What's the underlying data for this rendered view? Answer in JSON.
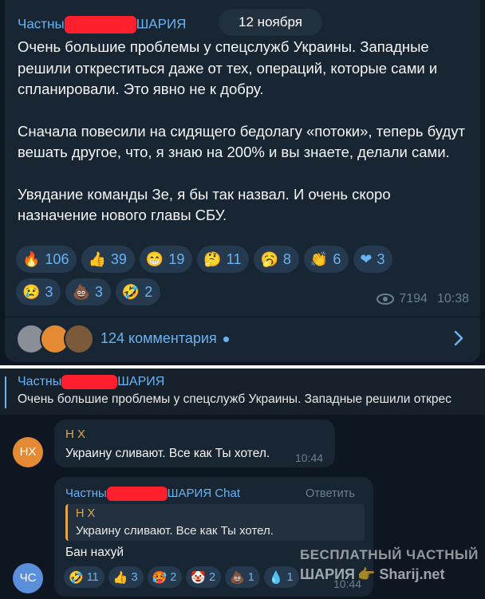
{
  "post": {
    "author_prefix": "Частны",
    "author_suffix": "ШАРИЯ",
    "date": "12 ноября",
    "paragraphs": [
      "Очень большие проблемы у спецслужб Украины. Западные решили откреститься даже от тех, операций, которые сами и спланировали. Это явно не к добру.",
      "Сначала повесили на сидящего бедолагу «потоки», теперь будут вешать другое, что, я знаю на 200% и вы знаете, делали сами.",
      "Увядание команды Зе, я бы так назвал. И очень скоро назначение нового главы СБУ."
    ],
    "reactions_row1": [
      {
        "icon": "fire-emoji",
        "emoji": "🔥",
        "count": "106"
      },
      {
        "icon": "thumbs-up-emoji",
        "emoji": "👍",
        "count": "39"
      },
      {
        "icon": "grin-emoji",
        "emoji": "😁",
        "count": "19"
      },
      {
        "icon": "thinking-emoji",
        "emoji": "🤔",
        "count": "11"
      },
      {
        "icon": "yawn-emoji",
        "emoji": "🥱",
        "count": "8"
      },
      {
        "icon": "clap-emoji",
        "emoji": "👏",
        "count": "6"
      },
      {
        "icon": "heart-emoji",
        "emoji": "❤",
        "count": "3"
      }
    ],
    "reactions_row2": [
      {
        "icon": "crying-emoji",
        "emoji": "😢",
        "count": "3"
      },
      {
        "icon": "poop-emoji",
        "emoji": "💩",
        "count": "3"
      },
      {
        "icon": "rofl-emoji",
        "emoji": "🤣",
        "count": "2"
      }
    ],
    "views": "7194",
    "time": "10:38",
    "comments_label": "124 комментария"
  },
  "pinned": {
    "title_prefix": "Частны",
    "title_suffix": "ШАРИЯ",
    "text": "Очень большие проблемы у спецслужб Украины. Западные решили открес"
  },
  "message1": {
    "avatar": "НХ",
    "avatar_color": "#e48a35",
    "name": "Н Х",
    "text": "Украину сливают. Все как Ты хотел.",
    "time": "10:44"
  },
  "message2": {
    "avatar": "ЧС",
    "avatar_color": "#5b8fdc",
    "name_prefix": "Частны",
    "name_suffix": "ШАРИЯ Chat",
    "role": "Ответить",
    "quote_name": "Н Х",
    "quote_text": "Украину сливают. Все как Ты хотел.",
    "text": "Бан нахуй",
    "time": "10:44",
    "reactions": [
      {
        "icon": "rofl-emoji",
        "emoji": "🤣",
        "count": "11"
      },
      {
        "icon": "thumbs-up-emoji",
        "emoji": "👍",
        "count": "3"
      },
      {
        "icon": "hot-face-emoji",
        "emoji": "🥵",
        "count": "2"
      },
      {
        "icon": "clown-emoji",
        "emoji": "🤡",
        "count": "2"
      },
      {
        "icon": "poop-emoji",
        "emoji": "💩",
        "count": "1"
      },
      {
        "icon": "water-emoji",
        "emoji": "💧",
        "count": "1"
      }
    ]
  },
  "watermark": {
    "line1": "БЕСПЛАТНЫЙ ЧАСТНЫЙ",
    "line2a": "ШАРИЯ",
    "line2b": "Sharij.net"
  },
  "colors": {
    "background": "#0e1621",
    "bubble": "#182533",
    "accent": "#6ab3f3",
    "redaction": "#ff1f2d"
  }
}
